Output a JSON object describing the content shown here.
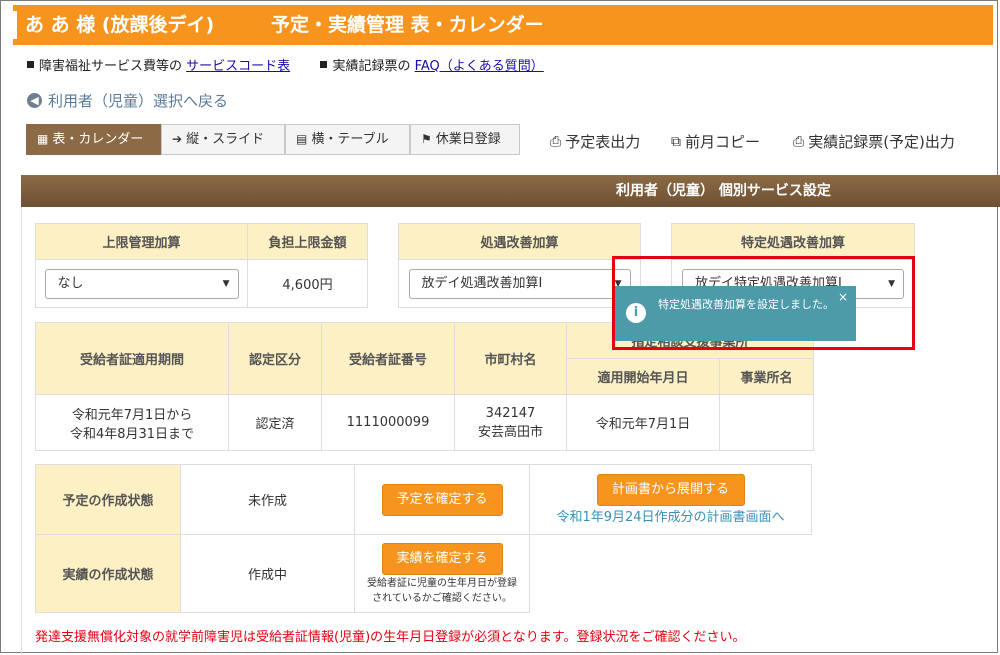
{
  "header": {
    "user_name": "あ あ 様 (放課後デイ)",
    "page_title": "予定・実績管理 表・カレンダー"
  },
  "links": {
    "service_code_prefix": "障害福祉サービス費等の",
    "service_code_link": "サービスコード表",
    "record_prefix": "実績記録票の",
    "faq_link": "FAQ（よくある質問）"
  },
  "nav": {
    "back_label": "利用者（児童）選択へ戻る"
  },
  "tabs": [
    {
      "label": "表・カレンダー",
      "icon": "calendar-icon"
    },
    {
      "label": "縦・スライド",
      "icon": "login-arrow-icon"
    },
    {
      "label": "横・テーブル",
      "icon": "table-icon"
    },
    {
      "label": "休業日登録",
      "icon": "flag-icon"
    }
  ],
  "actions": {
    "print_schedule": "予定表出力",
    "copy_prev_month": "前月コピー",
    "print_record": "実績記録票(予定)出力"
  },
  "section_title": "利用者（児童） 個別サービス設定",
  "limit_table": {
    "col1": "上限管理加算",
    "col2": "負担上限金額",
    "select_value": "なし",
    "amount": "4,600円"
  },
  "treatment": {
    "header": "処遇改善加算",
    "select_value": "放デイ処遇改善加算Ⅰ"
  },
  "special_treatment": {
    "header": "特定処遇改善加算",
    "select_value": "放デイ特定処遇改善加算Ⅰ"
  },
  "toast": {
    "message": "特定処遇改善加算を設定しました。",
    "close": "×"
  },
  "cert_table": {
    "period_header": "受給者証適用期間",
    "cert_type_header": "認定区分",
    "cert_no_header": "受給者証番号",
    "city_header": "市町村名",
    "consult_header": "指定相談支援事業所",
    "start_header": "適用開始年月日",
    "office_header": "事業所名",
    "period_value_1": "令和元年7月1日から",
    "period_value_2": "令和4年8月31日まで",
    "cert_type_value": "認定済",
    "cert_no_value": "1111000099",
    "city_code": "342147",
    "city_name": "安芸高田市",
    "start_value": "令和元年7月1日",
    "office_value": ""
  },
  "status_table": {
    "plan_label": "予定の作成状態",
    "plan_value": "未作成",
    "plan_button": "予定を確定する",
    "expand_button": "計画書から展開する",
    "plan_link": "令和1年9月24日作成分の計画書画面へ",
    "actual_label": "実績の作成状態",
    "actual_value": "作成中",
    "actual_button": "実績を確定する",
    "actual_note_1": "受給者証に児童の生年月日が登録",
    "actual_note_2": "されているかご確認ください。"
  },
  "warning": "発達支援無償化対象の就学前障害児は受給者証情報(児童)の生年月日登録が必須となります。登録状況をご確認ください。"
}
